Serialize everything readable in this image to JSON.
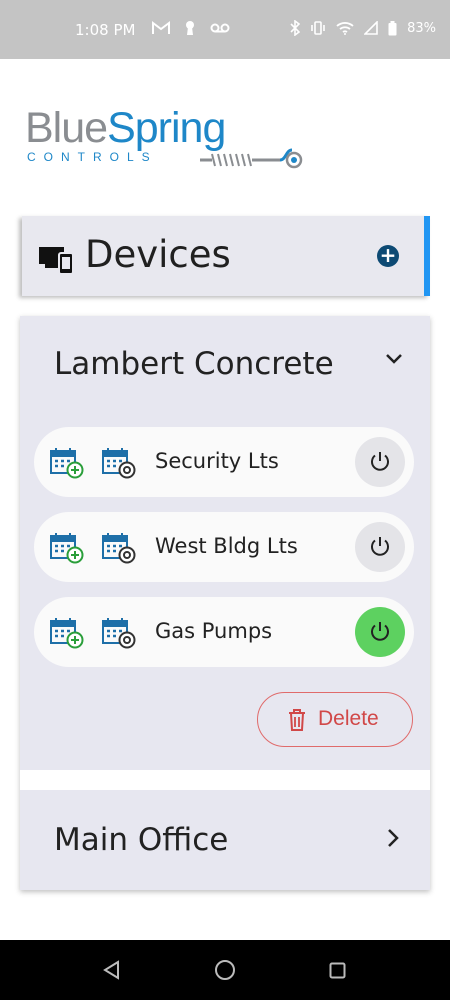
{
  "status_bar": {
    "time": "1:08 PM",
    "left_icons": [
      "gmail-icon",
      "keyhole-icon",
      "voicemail-icon"
    ],
    "right_icons": [
      "bluetooth-icon",
      "vibrate-icon",
      "wifi-icon",
      "signal-icon",
      "battery-icon"
    ],
    "battery": "83%"
  },
  "logo": {
    "word1": "Blue",
    "word2": "Spring",
    "tagline": "CONTROLS"
  },
  "devices_header": {
    "title": "Devices",
    "icon": "devices-icon",
    "add_icon": "add-circle-icon"
  },
  "groups": [
    {
      "name": "Lambert Concrete",
      "expanded": true,
      "devices": [
        {
          "label": "Security Lts",
          "power_on": false
        },
        {
          "label": "West Bldg Lts",
          "power_on": false
        },
        {
          "label": "Gas Pumps",
          "power_on": true
        }
      ],
      "delete_label": "Delete"
    },
    {
      "name": "Main Office",
      "expanded": false
    }
  ],
  "colors": {
    "accent": "#2196f3",
    "power_on": "#5dd160",
    "delete": "#d14848",
    "brand_blue": "#1e87c8",
    "brand_grey": "#8a8d91"
  },
  "nav": {
    "icons": [
      "back-icon",
      "home-icon",
      "recents-icon"
    ]
  }
}
